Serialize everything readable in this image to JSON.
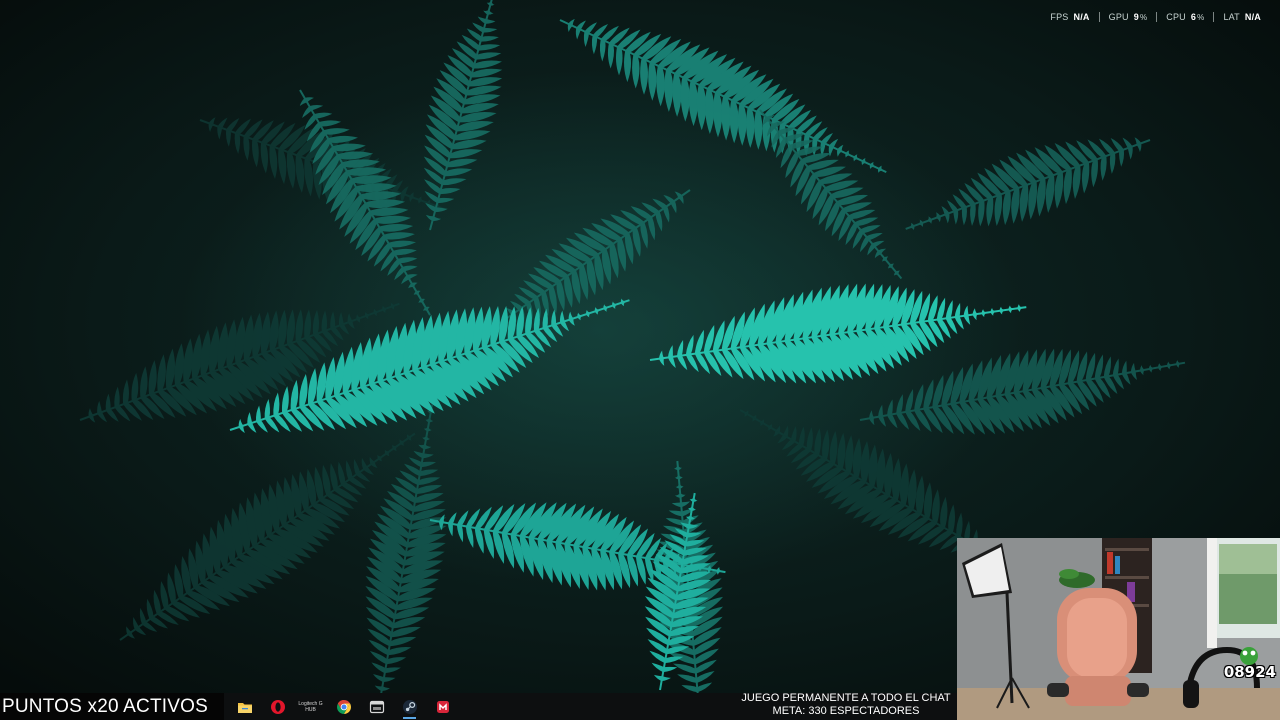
{
  "perf_overlay": {
    "items": [
      {
        "label": "FPS",
        "value": "N/A",
        "unit": ""
      },
      {
        "label": "GPU",
        "value": "9",
        "unit": "%"
      },
      {
        "label": "CPU",
        "value": "6",
        "unit": "%"
      },
      {
        "label": "LAT",
        "value": "N/A",
        "unit": ""
      }
    ]
  },
  "stream_banner": {
    "points_text": "PUNTOS x20 ACTIVOS"
  },
  "chat_message": {
    "line1": "JUEGO PERMANENTE A TODO EL CHAT",
    "line2": "META: 330 ESPECTADORES"
  },
  "webcam": {
    "counter": "08924"
  },
  "taskbar": {
    "icons": [
      {
        "name": "file-explorer-icon",
        "label": ""
      },
      {
        "name": "opera-icon",
        "label": ""
      },
      {
        "name": "logitech-ghub-icon",
        "label": "Logitech G HUB"
      },
      {
        "name": "chrome-icon",
        "label": ""
      },
      {
        "name": "app-window-icon",
        "label": ""
      },
      {
        "name": "steam-icon",
        "label": ""
      },
      {
        "name": "red-app-icon",
        "label": ""
      }
    ]
  },
  "colors": {
    "wallpaper_dark": "#0b1413",
    "fern_teal": "#1fb0a0",
    "taskbar_bg": "#0d0f10",
    "accent": "#5aa7e6"
  }
}
